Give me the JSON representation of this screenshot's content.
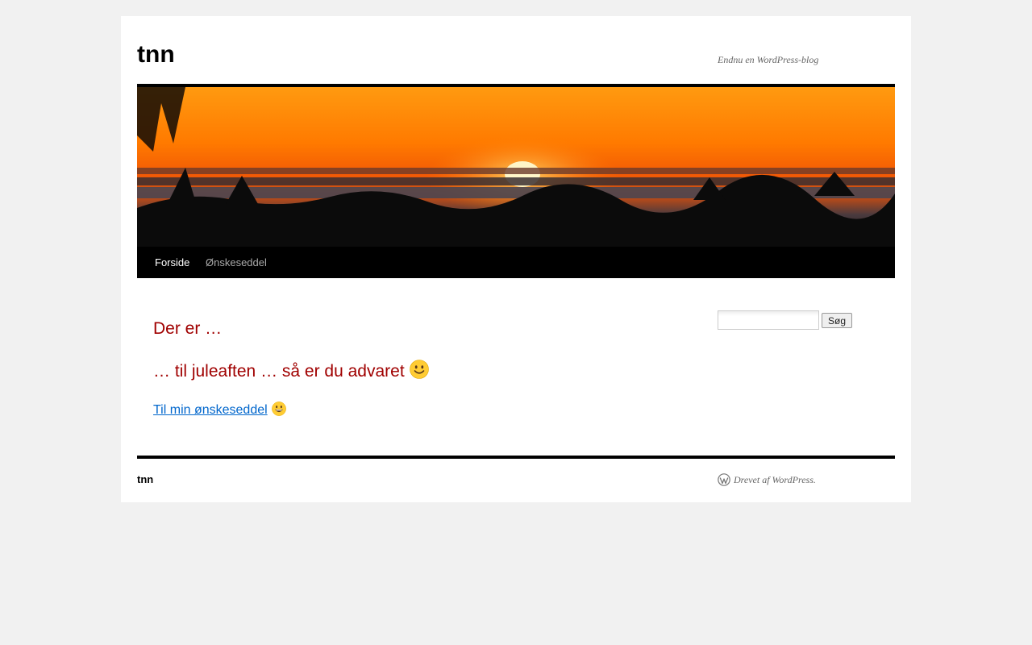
{
  "header": {
    "site_title": "tnn",
    "site_description": "Endnu en WordPress-blog"
  },
  "nav": {
    "items": [
      {
        "label": "Forside",
        "current": true
      },
      {
        "label": "Ønskeseddel",
        "current": false
      }
    ]
  },
  "content": {
    "titles": [
      "Der er …",
      "… til juleaften … så er du advaret"
    ],
    "link_label": "Til min ønskeseddel",
    "title_emoji_icon": "slightly-smiling-face-icon",
    "link_emoji_icon": "grinning-face-icon"
  },
  "search": {
    "placeholder": "",
    "value": "",
    "button_label": "Søg"
  },
  "footer": {
    "site_title": "tnn",
    "generator_text": "Drevet af WordPress."
  },
  "colors": {
    "page_bg": "#f1f1f1",
    "title_red": "#a00000",
    "link_blue": "#0066cc",
    "nav_bg": "#000000"
  }
}
